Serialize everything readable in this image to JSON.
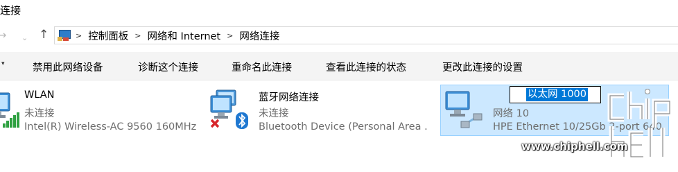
{
  "window": {
    "title": "连接"
  },
  "address_bar": {
    "crumbs": [
      "控制面板",
      "网络和 Internet",
      "网络连接"
    ]
  },
  "command_bar": {
    "items": [
      "禁用此网络设备",
      "诊断这个连接",
      "重命名此连接",
      "查看此连接的状态",
      "更改此连接的设置"
    ]
  },
  "connections": [
    {
      "name": "WLAN",
      "status": "未连接",
      "device": "Intel(R) Wireless-AC 9560 160MHz",
      "icon": "wifi-adapter-icon"
    },
    {
      "name": "蓝牙网络连接",
      "status": "未连接",
      "device": "Bluetooth Device (Personal Area ...",
      "icon": "bluetooth-adapter-icon"
    },
    {
      "name": "以太网 1000",
      "status": "网络 10",
      "device": "HPE Ethernet 10/25Gb 2-port 640...",
      "icon": "ethernet-adapter-icon",
      "selected": true,
      "renaming": true
    }
  ],
  "watermark": {
    "url": "www.chiphell.com",
    "logo": "chip hell"
  },
  "colors": {
    "selection_bg": "#cce8ff",
    "selection_border": "#99d1ff",
    "text_selection": "#0078d7"
  }
}
